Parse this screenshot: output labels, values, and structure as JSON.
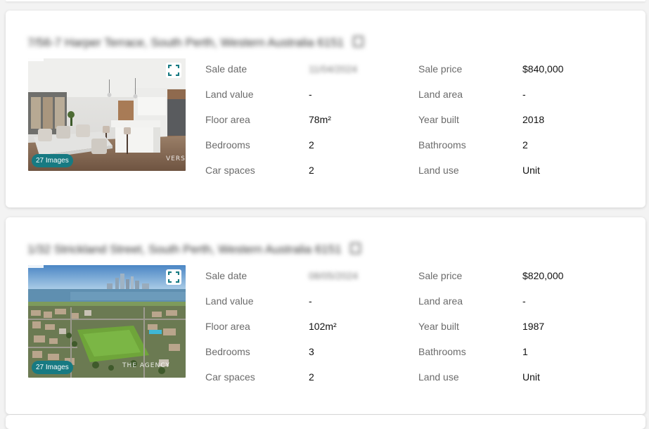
{
  "listings": [
    {
      "address": "7/56-7 Harper Terrace, South Perth, Western Australia 6151",
      "image_count_label": "27 Images",
      "photo_watermark": "VERSE",
      "sale_date_label": "Sale date",
      "sale_date": "11/04/2024",
      "sale_price_label": "Sale price",
      "sale_price": "$840,000",
      "land_value_label": "Land value",
      "land_value": "-",
      "land_area_label": "Land area",
      "land_area": "-",
      "floor_area_label": "Floor area",
      "floor_area": "78m²",
      "year_built_label": "Year built",
      "year_built": "2018",
      "bedrooms_label": "Bedrooms",
      "bedrooms": "2",
      "bathrooms_label": "Bathrooms",
      "bathrooms": "2",
      "car_spaces_label": "Car spaces",
      "car_spaces": "2",
      "land_use_label": "Land use",
      "land_use": "Unit"
    },
    {
      "address": "1/32 Strickland Street, South Perth, Western Australia 6151",
      "image_count_label": "27 Images",
      "photo_watermark": "THE AGENCY",
      "sale_date_label": "Sale date",
      "sale_date": "08/05/2024",
      "sale_price_label": "Sale price",
      "sale_price": "$820,000",
      "land_value_label": "Land value",
      "land_value": "-",
      "land_area_label": "Land area",
      "land_area": "-",
      "floor_area_label": "Floor area",
      "floor_area": "102m²",
      "year_built_label": "Year built",
      "year_built": "1987",
      "bedrooms_label": "Bedrooms",
      "bedrooms": "3",
      "bathrooms_label": "Bathrooms",
      "bathrooms": "1",
      "car_spaces_label": "Car spaces",
      "car_spaces": "2",
      "land_use_label": "Land use",
      "land_use": "Unit"
    }
  ],
  "icons": {
    "expand": "expand-icon",
    "copy": "copy-icon"
  },
  "colors": {
    "accent_teal": "#177a82",
    "badge_bg": "#177a82",
    "label_gray": "#6b6b6b",
    "value_black": "#111111",
    "page_bg": "#f3f3f3",
    "card_bg": "#ffffff"
  }
}
